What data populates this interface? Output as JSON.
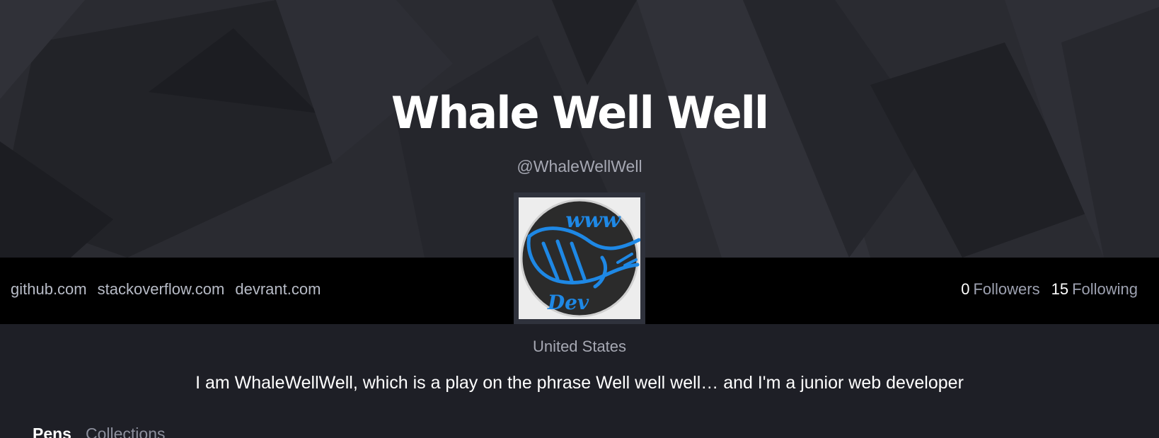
{
  "profile": {
    "name": "Whale Well Well",
    "handle": "@WhaleWellWell",
    "location": "United States",
    "bio": "I am WhaleWellWell, which is a play on the phrase Well well well… and I'm a junior web developer",
    "avatar": {
      "top_text": "www",
      "bottom_text": "Dev",
      "accent": "#1e88e5",
      "icon": "whale-logo-icon"
    }
  },
  "links": [
    {
      "label": "github.com"
    },
    {
      "label": "stackoverflow.com"
    },
    {
      "label": "devrant.com"
    }
  ],
  "stats": {
    "followers": {
      "count": "0",
      "label": "Followers"
    },
    "following": {
      "count": "15",
      "label": "Following"
    }
  },
  "tabs": [
    {
      "label": "Pens",
      "active": true
    },
    {
      "label": "Collections",
      "active": false
    }
  ],
  "colors": {
    "hero_bg": "#2a2b31",
    "bar_bg": "#000000",
    "page_bg": "#1e1f26"
  }
}
